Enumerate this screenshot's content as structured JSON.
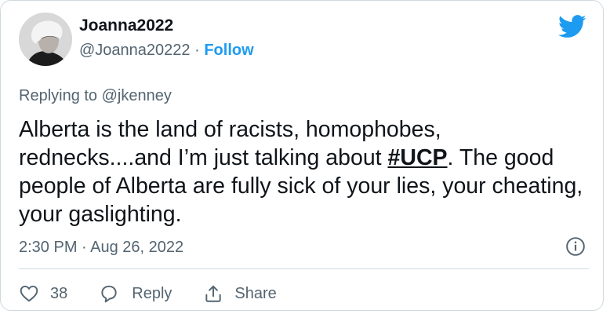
{
  "author": {
    "display_name": "Joanna2022",
    "handle": "@Joanna20222",
    "separator": "·",
    "follow_label": "Follow"
  },
  "reply_context": {
    "prefix": "Replying to",
    "handle": "@jkenney"
  },
  "tweet": {
    "text_before": "Alberta is the land of racists, homophobes, rednecks....and I’m just talking about ",
    "hashtag": "#UCP",
    "text_after": ".  The good people of Alberta are fully sick of your lies, your cheating, your gaslighting."
  },
  "timestamp": "2:30 PM · Aug 26, 2022",
  "actions": {
    "like_count": "38",
    "reply_label": "Reply",
    "share_label": "Share"
  },
  "icons": {
    "brand": "twitter-bird-icon",
    "info": "info-icon",
    "like": "heart-icon",
    "reply": "speech-bubble-icon",
    "share": "share-icon"
  },
  "colors": {
    "brand_blue": "#1d9bf0",
    "text_primary": "#0f1419",
    "text_secondary": "#536471",
    "border": "#cfd9de"
  }
}
